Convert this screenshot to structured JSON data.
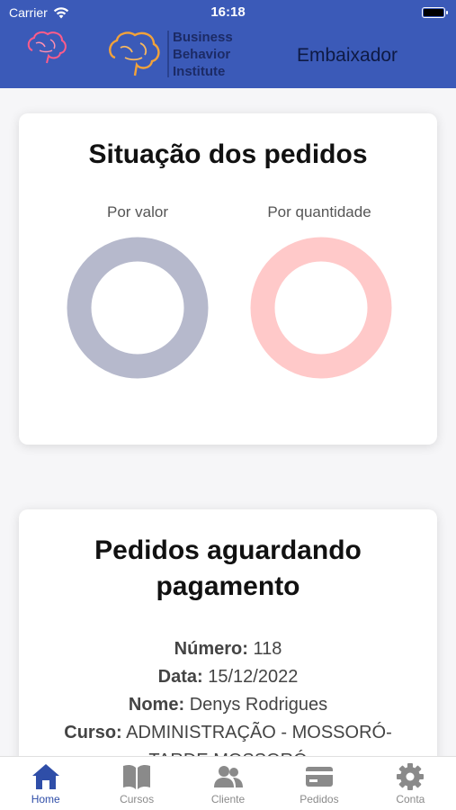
{
  "status_bar": {
    "carrier": "Carrier",
    "time": "16:18"
  },
  "header": {
    "logo_lines": [
      "Business",
      "Behavior",
      "Institute"
    ],
    "title": "Embaixador"
  },
  "orders_status": {
    "title": "Situação dos pedidos",
    "by_value_label": "Por valor",
    "by_quantity_label": "Por quantidade"
  },
  "pending": {
    "title": "Pedidos aguardando pagamento",
    "numero_label": "Número:",
    "numero": "118",
    "data_label": "Data:",
    "data": "15/12/2022",
    "nome_label": "Nome:",
    "nome": "Denys Rodrigues",
    "curso_label": "Curso:",
    "curso_line1": "ADMINISTRAÇÃO - MOSSORÓ-",
    "curso_line2": "TARDE  MOSSORÓ"
  },
  "tabs": [
    {
      "label": "Home",
      "icon": "home-icon",
      "active": true
    },
    {
      "label": "Cursos",
      "icon": "book-icon",
      "active": false
    },
    {
      "label": "Cliente",
      "icon": "users-icon",
      "active": false
    },
    {
      "label": "Pedidos",
      "icon": "card-icon",
      "active": false
    },
    {
      "label": "Conta",
      "icon": "gear-icon",
      "active": false
    }
  ],
  "colors": {
    "header": "#3b5ab8",
    "donut_value": "#b6b9cc",
    "donut_quantity": "#ffc9c9",
    "tab_active": "#2f4ea8",
    "tab_inactive": "#8a8a8a"
  }
}
